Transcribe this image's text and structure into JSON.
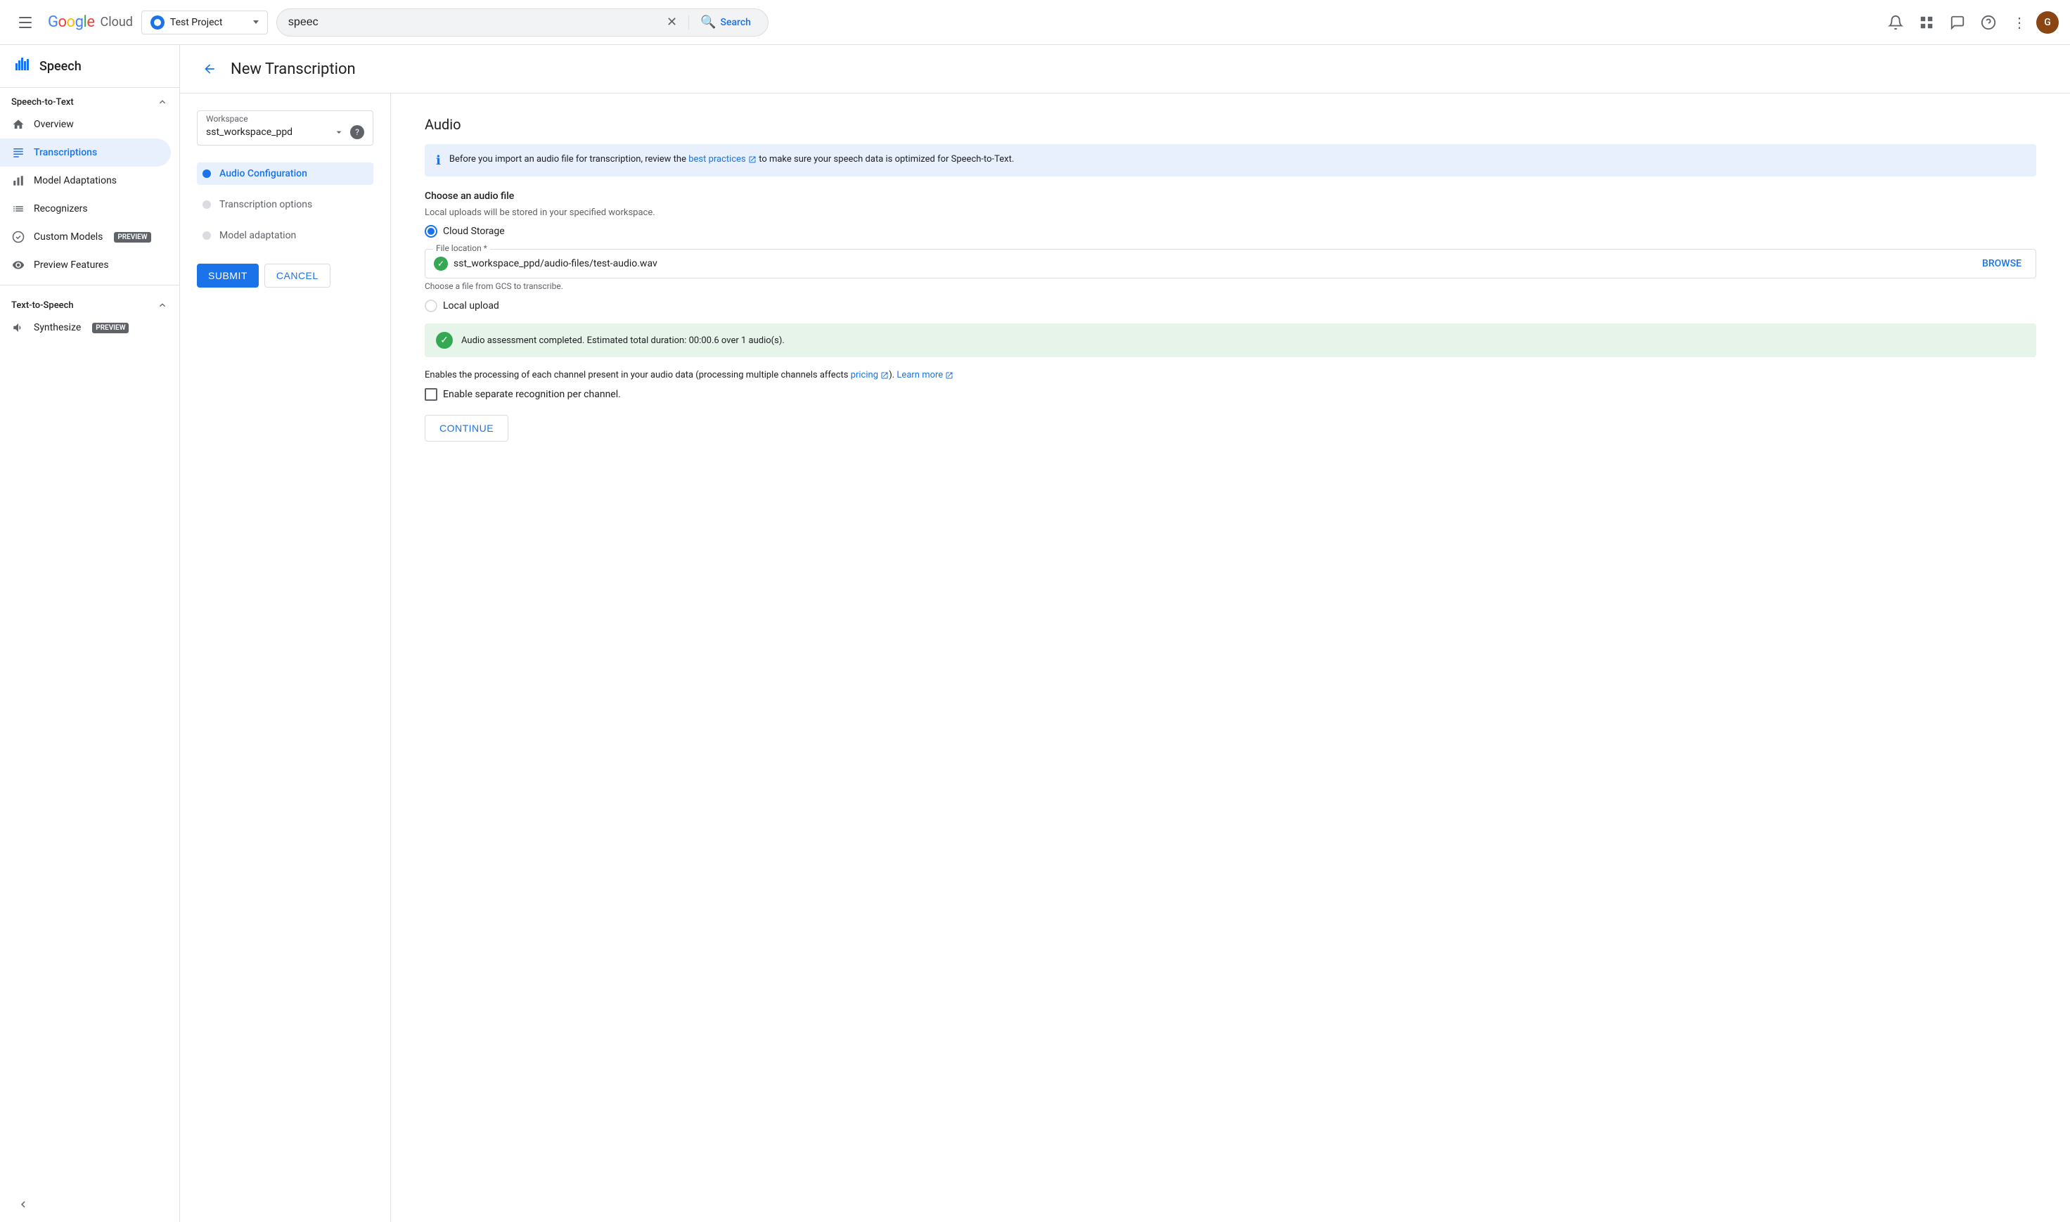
{
  "app": {
    "name": "Speech",
    "logo_google": "Google",
    "logo_cloud": "Cloud"
  },
  "topnav": {
    "project_name": "Test Project",
    "search_value": "speec",
    "search_placeholder": "Search",
    "search_button_label": "Search"
  },
  "sidebar": {
    "speech_to_text_label": "Speech-to-Text",
    "items": [
      {
        "id": "overview",
        "label": "Overview",
        "icon": "home"
      },
      {
        "id": "transcriptions",
        "label": "Transcriptions",
        "icon": "list",
        "active": true
      },
      {
        "id": "model-adaptations",
        "label": "Model Adaptations",
        "icon": "bar-chart"
      },
      {
        "id": "recognizers",
        "label": "Recognizers",
        "icon": "list-alt"
      },
      {
        "id": "custom-models",
        "label": "Custom Models",
        "icon": "star",
        "badge": "PREVIEW"
      },
      {
        "id": "preview-features",
        "label": "Preview Features",
        "icon": "visibility"
      }
    ],
    "text_to_speech_label": "Text-to-Speech",
    "tts_items": [
      {
        "id": "synthesize",
        "label": "Synthesize",
        "icon": "audio",
        "badge": "PREVIEW"
      }
    ]
  },
  "page": {
    "title": "New Transcription",
    "back_label": "back"
  },
  "workspace": {
    "label": "Workspace",
    "value": "sst_workspace_ppd",
    "help_tooltip": "?"
  },
  "wizard": {
    "steps": [
      {
        "id": "audio-config",
        "label": "Audio Configuration",
        "active": true
      },
      {
        "id": "transcription-options",
        "label": "Transcription options",
        "active": false
      },
      {
        "id": "model-adaptation",
        "label": "Model adaptation",
        "active": false
      }
    ],
    "submit_label": "SUBMIT",
    "cancel_label": "CANCEL"
  },
  "audio": {
    "section_title": "Audio",
    "info_text_prefix": "Before you import an audio file for transcription, review the ",
    "info_link_text": "best practices",
    "info_text_suffix": " to make sure your speech data is optimized for Speech-to-Text.",
    "choose_file_label": "Choose an audio file",
    "local_upload_note": "Local uploads will be stored in your specified workspace.",
    "cloud_storage_label": "Cloud Storage",
    "local_upload_label": "Local upload",
    "file_location_label": "File location *",
    "file_path": "sst_workspace_ppd/audio-files/test-audio.wav",
    "browse_label": "BROWSE",
    "file_helper": "Choose a file from GCS to transcribe.",
    "assessment_text": "Audio assessment completed. Estimated total duration: 00:00.6 over 1 audio(s).",
    "channel_info": "Enables the processing of each channel present in your audio data (processing multiple channels affects ",
    "pricing_link": "pricing",
    "channel_info_mid": "). ",
    "learn_more_link": "Learn more",
    "channel_checkbox_label": "Enable separate recognition per channel.",
    "continue_label": "CONTINUE"
  }
}
